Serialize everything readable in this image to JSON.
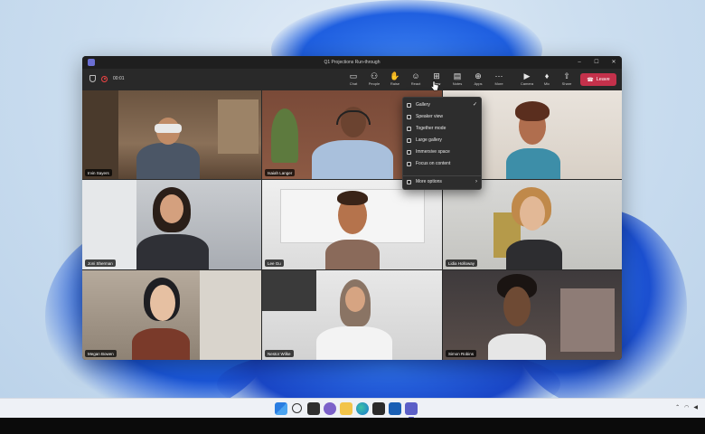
{
  "window": {
    "title": "Q1 Projections Run-through",
    "timer": "00:01",
    "controls": {
      "minimize": "–",
      "maximize": "☐",
      "close": "✕"
    }
  },
  "toolbar": {
    "buttons": [
      {
        "label": "Chat",
        "icon": "chat-icon"
      },
      {
        "label": "People",
        "icon": "people-icon"
      },
      {
        "label": "Raise",
        "icon": "raise-hand-icon"
      },
      {
        "label": "React",
        "icon": "react-icon"
      },
      {
        "label": "View",
        "icon": "view-icon"
      },
      {
        "label": "Notes",
        "icon": "notes-icon"
      },
      {
        "label": "Apps",
        "icon": "apps-icon"
      },
      {
        "label": "More",
        "icon": "more-icon"
      },
      {
        "label": "Camera",
        "icon": "camera-icon"
      },
      {
        "label": "Mic",
        "icon": "mic-icon"
      },
      {
        "label": "Share",
        "icon": "share-icon"
      }
    ],
    "leave_label": "Leave"
  },
  "view_menu": {
    "items": [
      {
        "label": "Gallery",
        "selected": true
      },
      {
        "label": "Speaker view"
      },
      {
        "label": "Together mode"
      },
      {
        "label": "Large gallery"
      },
      {
        "label": "Immersive space"
      },
      {
        "label": "Focus on content"
      }
    ],
    "more_label": "More options"
  },
  "participants": [
    {
      "name": "Irvin Sayers"
    },
    {
      "name": "Isaiah Langer"
    },
    {
      "name": ""
    },
    {
      "name": "Joni Sherman"
    },
    {
      "name": "Lee Gu"
    },
    {
      "name": "Lidia Holloway"
    },
    {
      "name": "Megan Bowen"
    },
    {
      "name": "Nestor Wilke"
    },
    {
      "name": "Simon Robins"
    }
  ],
  "colors": {
    "accent": "#7f85f5",
    "leave": "#c4314b",
    "window_bg": "#292929"
  }
}
